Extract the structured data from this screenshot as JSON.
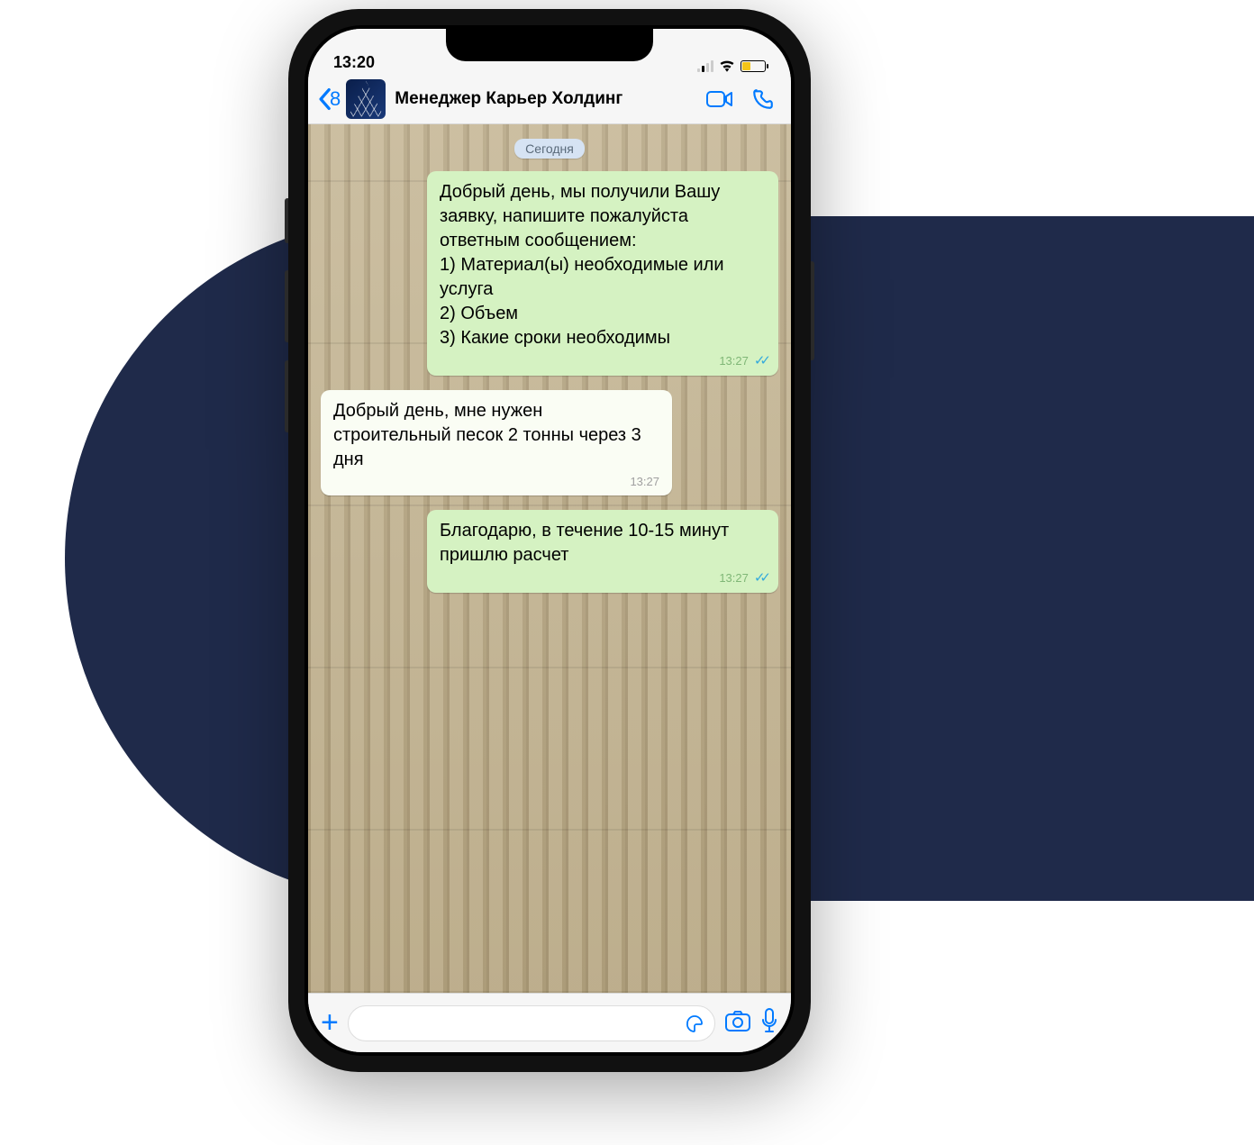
{
  "status": {
    "time": "13:20"
  },
  "header": {
    "back_count": "8",
    "title": "Менеджер Карьер Холдинг"
  },
  "chat": {
    "date_label": "Сегодня",
    "messages": [
      {
        "dir": "out",
        "text": "Добрый день, мы получили Вашу заявку, напишите пожалуйста ответным сообщением:\n1) Материал(ы) необходимые или услуга\n2) Объем\n3) Какие сроки необходимы",
        "time": "13:27",
        "read": true
      },
      {
        "dir": "in",
        "text": "Добрый день, мне нужен строительный песок 2 тонны через 3 дня",
        "time": "13:27",
        "read": false
      },
      {
        "dir": "out",
        "text": "Благодарю, в течение 10-15 минут пришлю расчет",
        "time": "13:27",
        "read": true
      }
    ]
  }
}
